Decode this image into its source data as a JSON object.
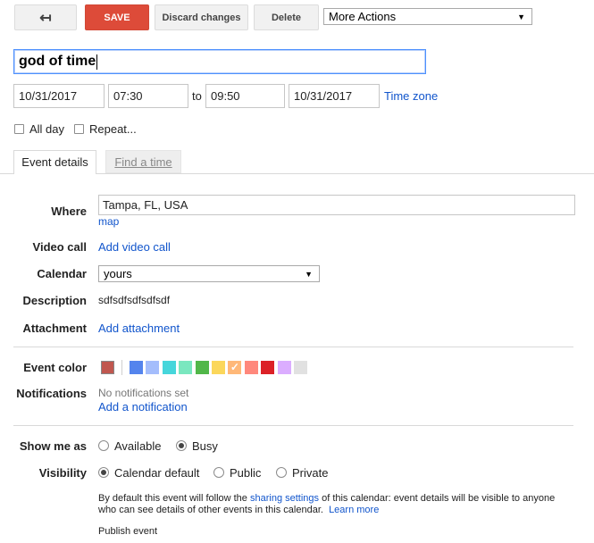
{
  "toolbar": {
    "back_icon": "↤",
    "save_label": "SAVE",
    "discard_label": "Discard changes",
    "delete_label": "Delete",
    "more_actions": "More Actions"
  },
  "event": {
    "title": "god of time",
    "start_date": "10/31/2017",
    "start_time": "07:30",
    "to_label": "to",
    "end_time": "09:50",
    "end_date": "10/31/2017",
    "time_zone_label": "Time zone",
    "all_day_label": "All day",
    "repeat_label": "Repeat..."
  },
  "tabs": {
    "event_details": "Event details",
    "find_a_time": "Find a time"
  },
  "details": {
    "where_label": "Where",
    "where_value": "Tampa, FL, USA",
    "map_link": "map",
    "video_call_label": "Video call",
    "add_video_call": "Add video call",
    "calendar_label": "Calendar",
    "calendar_value": "yours",
    "description_label": "Description",
    "description_value": "sdfsdfsdfsdfsdf",
    "attachment_label": "Attachment",
    "add_attachment": "Add attachment"
  },
  "colors": {
    "label": "Event color",
    "current": "#c0574f",
    "swatches": [
      "#5484ed",
      "#a4bdfc",
      "#46d6db",
      "#7ae7bf",
      "#51b749",
      "#fbd75b",
      "#ffb878",
      "#ff887c",
      "#dc2127",
      "#dbadff",
      "#e1e1e1"
    ],
    "selected_index": 6,
    "check_icon": "✓"
  },
  "notifications": {
    "label": "Notifications",
    "none_text": "No notifications set",
    "add_link": "Add a notification"
  },
  "show_me_as": {
    "label": "Show me as",
    "options": [
      "Available",
      "Busy"
    ],
    "selected": "Busy"
  },
  "visibility": {
    "label": "Visibility",
    "options": [
      "Calendar default",
      "Public",
      "Private"
    ],
    "selected": "Calendar default",
    "note_prefix": "By default this event will follow the ",
    "note_link": "sharing settings",
    "note_middle": " of this calendar: event details will be visible to anyone",
    "note_line2": "who can see details of other events in this calendar.",
    "learn_more": "Learn more",
    "publish_event": "Publish event"
  }
}
